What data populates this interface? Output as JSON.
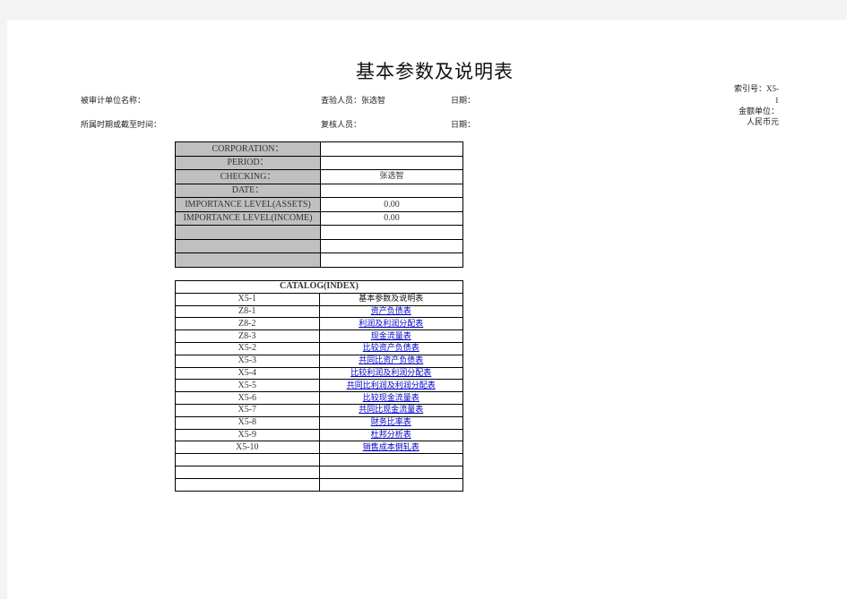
{
  "title": "基本参数及说明表",
  "header": {
    "audited_unit_label": "被审计单位名称：",
    "period_label": "所属时期或截至时间：",
    "checker_label": "查验人员：",
    "checker_value": "张选智",
    "reviewer_label": "复核人员：",
    "date_label_1": "日期：",
    "date_label_2": "日期：",
    "index_label": "索引号：",
    "index_value_line1": "X5-",
    "index_value_line2": "1",
    "currency_unit_label": "金额单位：",
    "currency_unit_value": "人民币元"
  },
  "params_table": {
    "rows": [
      {
        "label": "CORPORATION：",
        "value": ""
      },
      {
        "label": "PERIOD：",
        "value": ""
      },
      {
        "label": "CHECKING：",
        "value": "张选智"
      },
      {
        "label": "DATE：",
        "value": ""
      },
      {
        "label": "IMPORTANCE  LEVEL(ASSETS)",
        "value": "0.00"
      },
      {
        "label": "IMPORTANCE  LEVEL(INCOME)",
        "value": "0.00"
      },
      {
        "label": "",
        "value": ""
      },
      {
        "label": "",
        "value": ""
      },
      {
        "label": "",
        "value": ""
      }
    ]
  },
  "catalog_table": {
    "header": "CATALOG(INDEX)",
    "rows": [
      {
        "code": "X5-1",
        "name": "基本参数及说明表",
        "link": false
      },
      {
        "code": "Z8-1",
        "name": "资产负债表",
        "link": true
      },
      {
        "code": "Z8-2",
        "name": "利润及利润分配表",
        "link": true
      },
      {
        "code": "Z8-3",
        "name": "现金流量表",
        "link": true
      },
      {
        "code": "X5-2",
        "name": "比较资产负债表",
        "link": true
      },
      {
        "code": "X5-3",
        "name": "共同比资产负债表",
        "link": true
      },
      {
        "code": "X5-4",
        "name": "比较利润及利润分配表",
        "link": true
      },
      {
        "code": "X5-5",
        "name": "共同比利润及利润分配表",
        "link": true
      },
      {
        "code": "X5-6",
        "name": "比较现金流量表",
        "link": true
      },
      {
        "code": "X5-7",
        "name": "共同比现金流量表",
        "link": true
      },
      {
        "code": "X5-8",
        "name": "财务比率表",
        "link": true
      },
      {
        "code": "X5-9",
        "name": "杜邦分析表",
        "link": true
      },
      {
        "code": "X5-10",
        "name": "销售成本倒轧表",
        "link": true
      },
      {
        "code": "",
        "name": "",
        "link": false
      },
      {
        "code": "",
        "name": "",
        "link": false
      },
      {
        "code": "",
        "name": "",
        "link": false
      }
    ]
  }
}
